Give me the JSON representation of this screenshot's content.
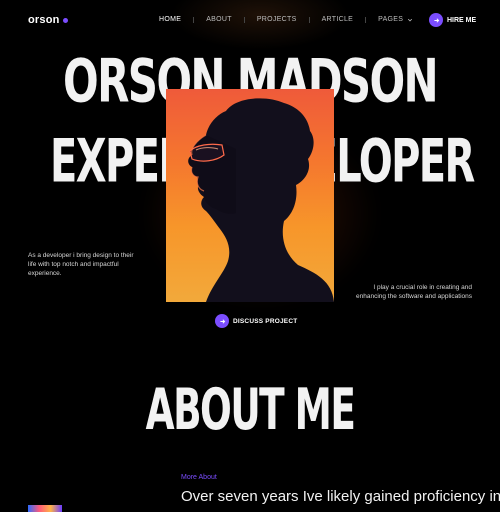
{
  "header": {
    "logo": "orson",
    "nav": [
      {
        "label": "HOME",
        "active": true
      },
      {
        "label": "ABOUT",
        "active": false
      },
      {
        "label": "PROJECTS",
        "active": false
      },
      {
        "label": "ARTICLE",
        "active": false
      },
      {
        "label": "PAGES",
        "active": false
      }
    ],
    "hire_label": "HIRE ME"
  },
  "hero": {
    "line1": "ORSON MADSON",
    "line2": "EXPERT DEVELOPER",
    "left_text": "As a developer i bring design to their life with top notch and impactful experience.",
    "right_text": "I play a crucial role in creating and enhancing the software and applications",
    "discuss_label": "DISCUSS PROJECT"
  },
  "about": {
    "title": "ABOUT ME",
    "eyebrow": "More About",
    "lead": "Over seven years Ive likely gained proficiency in"
  },
  "colors": {
    "accent": "#7b4dff",
    "background": "#000000",
    "text": "#f2f2f2"
  },
  "icons": [
    "arrow-right-icon",
    "chevron-down-icon"
  ]
}
